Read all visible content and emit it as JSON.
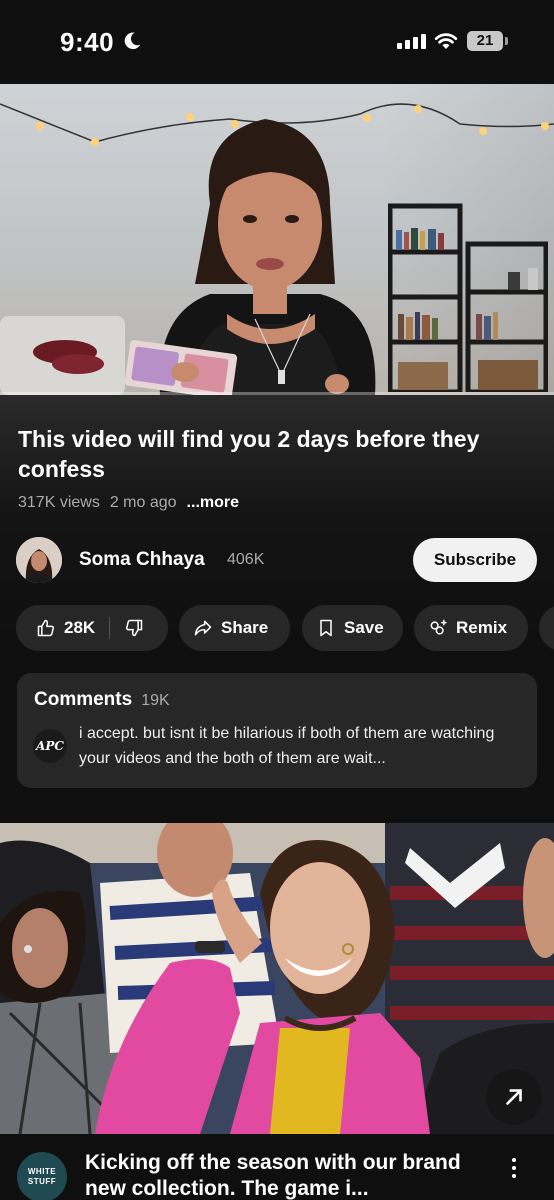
{
  "status_bar": {
    "time": "9:40",
    "battery": "21"
  },
  "player": {
    "progress_fraction": 0.0
  },
  "video": {
    "title": "This video will find you 2 days before they confess",
    "views": "317K views",
    "age": "2 mo ago",
    "more_label": "...more"
  },
  "channel": {
    "name": "Soma Chhaya",
    "subscribers": "406K",
    "subscribe_label": "Subscribe"
  },
  "actions": {
    "like_count": "28K",
    "share_label": "Share",
    "save_label": "Save",
    "remix_label": "Remix"
  },
  "comments": {
    "title": "Comments",
    "count": "19K",
    "avatar_text": "APC",
    "top_comment": "i accept. but isnt it be hilarious if both of them are watching your videos and the both of them are wait..."
  },
  "next_card": {
    "brand_avatar_text": "WHITE STUFF",
    "title": "Kicking off the season with our brand new collection. The game i..."
  },
  "colors": {
    "background": "#0f0f0f",
    "pill": "#272727",
    "accent_red": "#ff0000",
    "subscribe_bg": "#f1f1f1"
  },
  "icons": [
    "moon-icon",
    "signal-icon",
    "wifi-icon",
    "battery-icon",
    "thumbs-up-icon",
    "thumbs-down-icon",
    "share-icon",
    "save-icon",
    "remix-icon",
    "external-link-icon",
    "more-vert-icon"
  ]
}
